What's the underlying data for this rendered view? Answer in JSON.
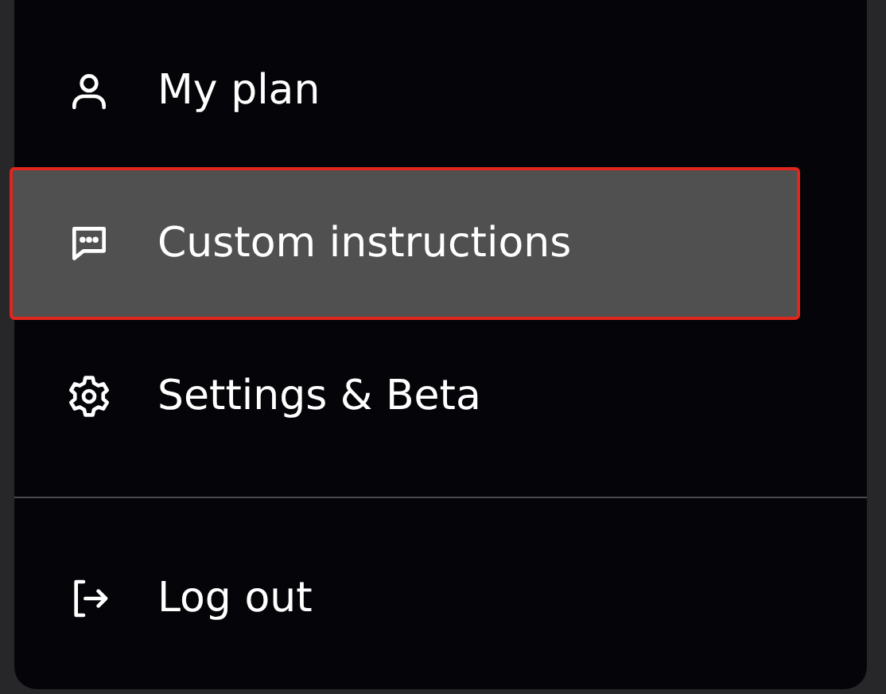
{
  "menu": {
    "sections": [
      {
        "items": [
          {
            "label": "My plan",
            "selected": false
          },
          {
            "label": "Custom instructions",
            "selected": true
          },
          {
            "label": "Settings & Beta",
            "selected": false
          }
        ]
      },
      {
        "items": [
          {
            "label": "Log out",
            "selected": false
          }
        ]
      }
    ]
  }
}
